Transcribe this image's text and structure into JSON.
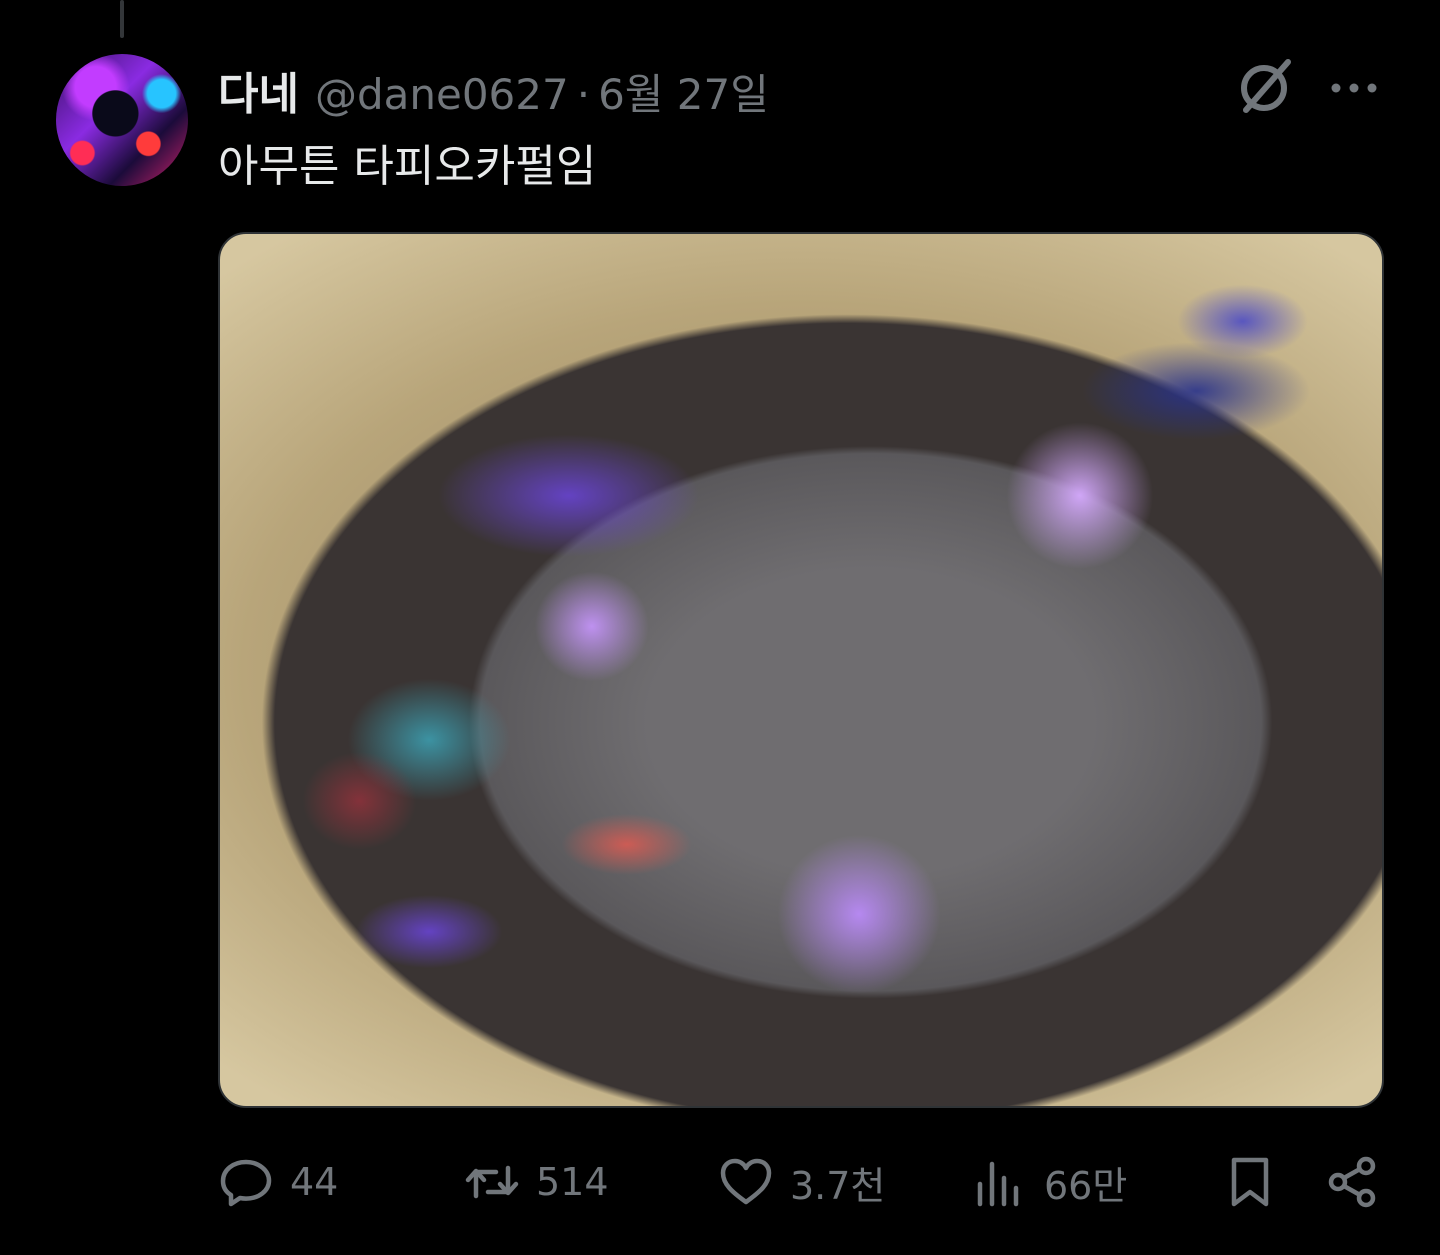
{
  "author": {
    "display_name": "다네",
    "handle": "@dane0627",
    "separator": "·",
    "date": "6월 27일"
  },
  "tweet": {
    "text": "아무튼 타피오카펄임"
  },
  "icons": {
    "grok": "grok-icon",
    "more": "more-icon",
    "reply": "reply-icon",
    "retweet": "retweet-icon",
    "like": "heart-icon",
    "views": "views-icon",
    "bookmark": "bookmark-icon",
    "share": "share-icon"
  },
  "actions": {
    "replies": "44",
    "retweets": "514",
    "likes": "3.7천",
    "views": "66만"
  },
  "colors": {
    "background": "#000000",
    "primary_text": "#e7e9ea",
    "secondary_text": "#71767b"
  }
}
